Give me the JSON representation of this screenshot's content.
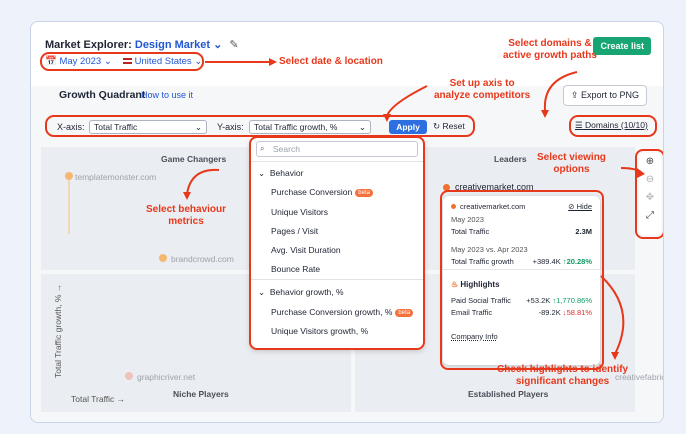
{
  "header": {
    "title_prefix": "Market Explorer:",
    "market": "Design Market",
    "create_button": "Create list",
    "date": "May 2023",
    "location": "United States"
  },
  "toolbar": {
    "panel_title": "Growth Quadrant",
    "how_to": "How to use it",
    "export": "Export to PNG",
    "x_label": "X-axis:",
    "x_value": "Total Traffic",
    "y_label": "Y-axis:",
    "y_value": "Total Traffic growth, %",
    "apply": "Apply",
    "reset": "Reset",
    "domains": "Domains (10/10)"
  },
  "quadrants": {
    "top_left": "Game Changers",
    "top_right": "Leaders",
    "bottom_left": "Niche Players",
    "bottom_right": "Established Players"
  },
  "chart": {
    "y_axis": "Total Traffic growth, % →",
    "x_axis": "Total Traffic →",
    "points": [
      "templatemonster.com",
      "brandcrowd.com",
      "graphicriver.net",
      "creativemarket.com",
      "creativefabrica.c"
    ]
  },
  "dropdown": {
    "search_placeholder": "Search",
    "group1": "Behavior",
    "items1": [
      "Purchase Conversion",
      "Unique Visitors",
      "Pages / Visit",
      "Avg. Visit Duration",
      "Bounce Rate"
    ],
    "group2": "Behavior growth, %",
    "items2": [
      "Purchase Conversion growth, %",
      "Unique Visitors growth, %"
    ],
    "beta": "beta"
  },
  "tooltip": {
    "domain": "creativemarket.com",
    "hide": "Hide",
    "period": "May 2023",
    "traffic_label": "Total Traffic",
    "traffic_value": "2.3M",
    "compare": "May 2023 vs. Apr 2023",
    "growth_label": "Total Traffic growth",
    "growth_abs": "+389.4K",
    "growth_pct": "↑20.28%",
    "highlights": "Highlights",
    "h1_label": "Paid Social Traffic",
    "h1_abs": "+53.2K",
    "h1_pct": "↑1,770.86%",
    "h2_label": "Email Traffic",
    "h2_abs": "-89.2K",
    "h2_pct": "↓58.81%",
    "company_info": "Company Info"
  },
  "annotations": {
    "date_location": "Select date & location",
    "domains": "Select domains &\nactive growth paths",
    "axis": "Set up axis to\nanalyze competitors",
    "behaviour": "Select behaviour\nmetrics",
    "viewing": "Select viewing\noptions",
    "highlights": "Check highlights to identify\nsignificant changes"
  },
  "colors": {
    "accent": "#e8381c",
    "brand_blue": "#2257d4",
    "green": "#17a673",
    "dot": "#f5b873"
  }
}
